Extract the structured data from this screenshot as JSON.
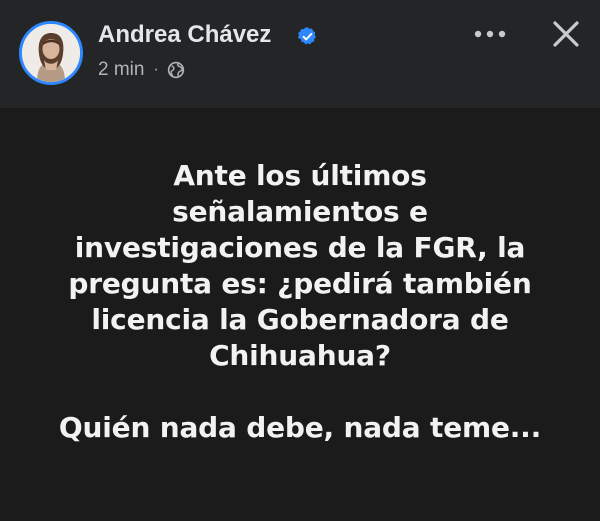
{
  "post": {
    "author_name": "Andrea Chávez",
    "timestamp": "2 min",
    "separator": "·",
    "audience_icon": "globe-icon",
    "verified_icon": "verified-badge-icon",
    "lines": [
      "Ante los últimos",
      "señalamientos e",
      "investigaciones de la FGR, la",
      "pregunta es: ¿pedirá también",
      "licencia la Gobernadora de",
      "Chihuahua?"
    ],
    "closing_line": "Quién nada debe, nada teme..."
  },
  "toolbar": {
    "more_icon": "more-options-icon",
    "close_icon": "close-icon"
  },
  "colors": {
    "header_bg": "#242526",
    "body_bg": "#1b1b1b",
    "text_primary": "#e4e6eb",
    "text_secondary": "#b0b3b8",
    "accent_blue": "#2d88ff"
  }
}
